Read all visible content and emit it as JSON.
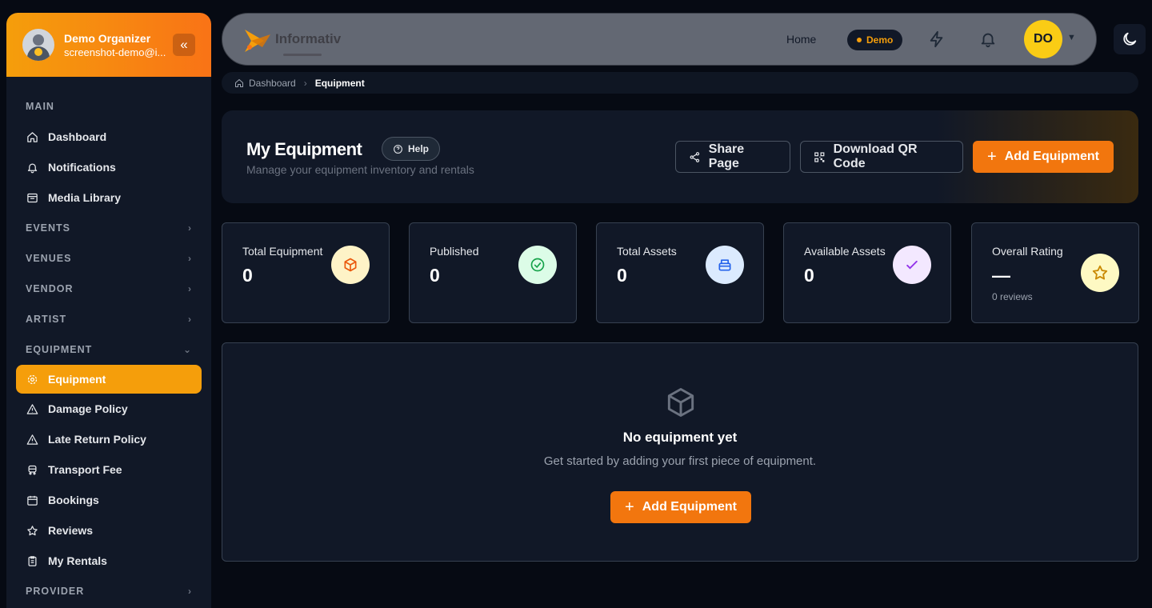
{
  "sidebar": {
    "user": {
      "name": "Demo Organizer",
      "email": "screenshot-demo@i..."
    },
    "collapse_glyph": "«",
    "sections": {
      "main": "MAIN",
      "events": "EVENTS",
      "venues": "VENUES",
      "vendor": "VENDOR",
      "artist": "ARTIST",
      "equipment": "EQUIPMENT",
      "provider": "PROVIDER"
    },
    "items": {
      "dashboard": "Dashboard",
      "notifications": "Notifications",
      "media_library": "Media Library",
      "equipment": "Equipment",
      "damage_policy": "Damage Policy",
      "late_return_policy": "Late Return Policy",
      "transport_fee": "Transport Fee",
      "bookings": "Bookings",
      "reviews": "Reviews",
      "my_rentals": "My Rentals"
    }
  },
  "topbar": {
    "logo_text": "Informativ",
    "home": "Home",
    "demo_badge": "Demo",
    "avatar_initials": "DO"
  },
  "breadcrumb": {
    "home": "Dashboard",
    "current": "Equipment"
  },
  "header": {
    "title": "My Equipment",
    "help": "Help",
    "subtitle": "Manage your equipment inventory and rentals",
    "share": "Share Page",
    "download_qr": "Download QR Code",
    "add": "Add Equipment"
  },
  "stats": [
    {
      "label": "Total Equipment",
      "value": "0",
      "icon": "box-icon"
    },
    {
      "label": "Published",
      "value": "0",
      "icon": "check-circle-icon"
    },
    {
      "label": "Total Assets",
      "value": "0",
      "icon": "archive-icon"
    },
    {
      "label": "Available Assets",
      "value": "0",
      "icon": "check-icon"
    },
    {
      "label": "Overall Rating",
      "value": "—",
      "sub": "0 reviews",
      "icon": "star-icon"
    }
  ],
  "empty_state": {
    "title": "No equipment yet",
    "text": "Get started by adding your first piece of equipment.",
    "button": "Add Equipment"
  },
  "colors": {
    "accent": "#f59e0b",
    "button": "#f2760e",
    "background": "#060a13",
    "card": "#111827"
  }
}
